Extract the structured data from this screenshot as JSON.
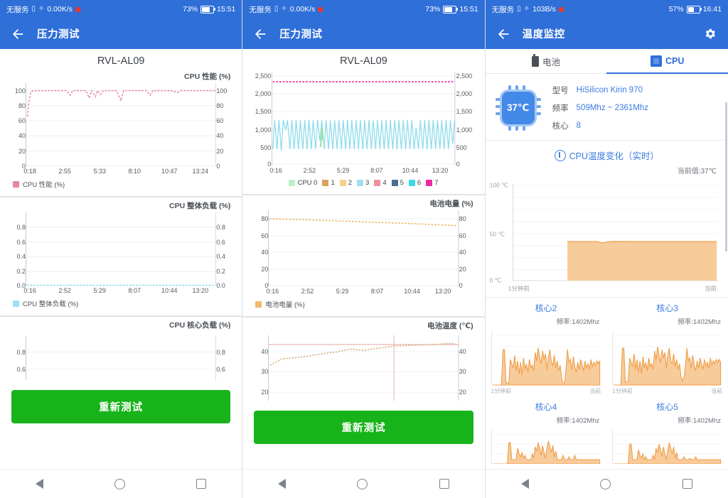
{
  "colors": {
    "brand_blue": "#2f6fd8",
    "green_button": "#18b31b",
    "cpu_perf_pink": "#e8879a",
    "cpu_load_cyan": "#9fdff0",
    "battery_orange": "#f0b96a",
    "temp_orange": "#f3b97c",
    "core_fill": "#f7cb9a",
    "core_stroke": "#f0a04b",
    "link_blue": "#3c7ce0"
  },
  "phone1": {
    "statusbar": {
      "carrier": "无服务",
      "sim_icon": "sim-card-icon",
      "wifi_icon": "wifi-icon",
      "net_speed": "0.00K/s",
      "record_icon": "recording-dot-icon",
      "battery_percent": "73%",
      "battery_icon": "battery-icon",
      "time": "15:51"
    },
    "appbar": {
      "back_icon": "back-arrow-icon",
      "title": "压力测试"
    },
    "device_name": "RVL-AL09",
    "charts": [
      {
        "subtitle": "CPU 性能 (%)",
        "y_ticks": [
          "100",
          "80",
          "60",
          "40",
          "20",
          "0"
        ],
        "x_ticks": [
          "0:18",
          "2:55",
          "5:33",
          "8:10",
          "10:47",
          "13:24"
        ],
        "legend": [
          {
            "label": "CPU 性能 (%)",
            "color": "#e8879a"
          }
        ]
      },
      {
        "subtitle": "CPU 整体负载 (%)",
        "y_ticks": [
          "0.8",
          "0.6",
          "0.4",
          "0.2",
          "0.0"
        ],
        "x_ticks": [
          "0:16",
          "2:52",
          "5:29",
          "8:07",
          "10:44",
          "13:20"
        ],
        "legend": [
          {
            "label": "CPU 整体负载 (%)",
            "color": "#9fdff0"
          }
        ]
      },
      {
        "subtitle": "CPU 核心负载 (%)",
        "y_ticks": [
          "0.8",
          "0.6"
        ],
        "x_ticks": [],
        "legend": []
      }
    ],
    "retest_button": "重新测试",
    "navbar": {
      "back": "nav-back-icon",
      "home": "nav-home-icon",
      "recents": "nav-recents-icon"
    }
  },
  "phone2": {
    "statusbar": {
      "carrier": "无服务",
      "sim_icon": "sim-card-icon",
      "wifi_icon": "wifi-icon",
      "net_speed": "0.00K/s",
      "record_icon": "recording-dot-icon",
      "battery_percent": "73%",
      "battery_icon": "battery-icon",
      "time": "15:51"
    },
    "appbar": {
      "back_icon": "back-arrow-icon",
      "title": "压力测试"
    },
    "device_name": "RVL-AL09",
    "charts": [
      {
        "subtitle": "",
        "y_ticks": [
          "2,500",
          "2,000",
          "1,500",
          "1,000",
          "500",
          "0"
        ],
        "x_ticks": [
          "0:16",
          "2:52",
          "5:29",
          "8:07",
          "10:44",
          "13:20"
        ],
        "legend": [
          {
            "label": "CPU 0",
            "color": "#bdf0c6"
          },
          {
            "label": "1",
            "color": "#d8a45c"
          },
          {
            "label": "2",
            "color": "#f6cf8a"
          },
          {
            "label": "3",
            "color": "#9fdff0"
          },
          {
            "label": "4",
            "color": "#f090a0"
          },
          {
            "label": "5",
            "color": "#4a6f8f"
          },
          {
            "label": "6",
            "color": "#3fd8e8"
          },
          {
            "label": "7",
            "color": "#ef2ba0"
          }
        ]
      },
      {
        "subtitle": "电池电量 (%)",
        "y_ticks": [
          "80",
          "60",
          "40",
          "20",
          "0"
        ],
        "x_ticks": [
          "0:16",
          "2:52",
          "5:29",
          "8:07",
          "10:44",
          "13:20"
        ],
        "legend": [
          {
            "label": "电池电量 (%)",
            "color": "#f0b96a"
          }
        ]
      },
      {
        "subtitle": "电池温度 (℃)",
        "y_ticks": [
          "40",
          "30",
          "20"
        ],
        "x_ticks": [],
        "legend": []
      }
    ],
    "retest_button": "重新测试",
    "navbar": {
      "back": "nav-back-icon",
      "home": "nav-home-icon",
      "recents": "nav-recents-icon"
    }
  },
  "phone3": {
    "statusbar": {
      "carrier": "无服务",
      "sim_icon": "sim-card-icon",
      "wifi_icon": "wifi-icon",
      "net_speed": "103B/s",
      "record_icon": "recording-dot-icon",
      "battery_percent": "57%",
      "battery_icon": "battery-icon",
      "time": "16:41"
    },
    "appbar": {
      "back_icon": "back-arrow-icon",
      "title": "温度监控",
      "settings_icon": "gear-icon"
    },
    "tabs": [
      {
        "label": "电池",
        "icon": "battery-icon",
        "active": false
      },
      {
        "label": "CPU",
        "icon": "cpu-chip-icon",
        "active": true
      }
    ],
    "cpu_info": {
      "chip_temp": "37℃",
      "rows": [
        {
          "key": "型号",
          "value": "HiSilicon Kirin 970"
        },
        {
          "key": "频率",
          "value": "509Mhz ~ 2361Mhz"
        },
        {
          "key": "核心",
          "value": "8"
        }
      ]
    },
    "temp_chart": {
      "title": "CPU温度变化（实时）",
      "title_icon": "thermometer-icon",
      "current_label": "当前值:37℃",
      "y_ticks": [
        "100 ℃",
        "50 ℃",
        "0 ℃"
      ],
      "x_left": "1分钟前",
      "x_right": "当前"
    },
    "cores": [
      {
        "title": "核心2",
        "freq": "频率:1402Mhz",
        "x_left": "1分钟前",
        "x_right": "当前"
      },
      {
        "title": "核心3",
        "freq": "频率:1402Mhz",
        "x_left": "1分钟前",
        "x_right": "当前"
      },
      {
        "title": "核心4",
        "freq": "频率:1402Mhz",
        "x_left": "1分钟前",
        "x_right": "当前"
      },
      {
        "title": "核心5",
        "freq": "频率:1402Mhz",
        "x_left": "1分钟前",
        "x_right": "当前"
      }
    ],
    "navbar": {
      "back": "nav-back-icon",
      "home": "nav-home-icon",
      "recents": "nav-recents-icon"
    }
  },
  "chart_data": [
    {
      "type": "line",
      "title": "CPU 性能 (%)",
      "xlabel": "",
      "ylabel": "CPU 性能 (%)",
      "ylim": [
        0,
        110
      ],
      "xtick_labels": [
        "0:18",
        "2:55",
        "5:33",
        "8:10",
        "10:47",
        "13:24"
      ],
      "ytick_labels": [
        "0",
        "20",
        "40",
        "60",
        "80",
        "100"
      ],
      "series": [
        {
          "name": "CPU 性能 (%)",
          "color": "#e8879a",
          "values": [
            65,
            84,
            97,
            100,
            100,
            100,
            100,
            100,
            100,
            100,
            100,
            100,
            100,
            100,
            100,
            100,
            96,
            100,
            100,
            100,
            100,
            100,
            90,
            100,
            94,
            100,
            92,
            100,
            96,
            100,
            100,
            100,
            100,
            100,
            100,
            86,
            100,
            100,
            100,
            100,
            100,
            100,
            100,
            96,
            100,
            100,
            100,
            100,
            98,
            100,
            100,
            100,
            100,
            100
          ]
        }
      ]
    },
    {
      "type": "line",
      "title": "CPU 整体负载 (%)",
      "ylabel": "CPU 整体负载 (%)",
      "ylim": [
        0,
        0.9
      ],
      "xtick_labels": [
        "0:16",
        "2:52",
        "5:29",
        "8:07",
        "10:44",
        "13:20"
      ],
      "ytick_labels": [
        "0.0",
        "0.2",
        "0.4",
        "0.6",
        "0.8"
      ],
      "series": [
        {
          "name": "CPU 整体负载 (%)",
          "color": "#9fdff0",
          "values": [
            0,
            0,
            0,
            0,
            0,
            0,
            0,
            0,
            0,
            0
          ]
        }
      ]
    },
    {
      "type": "line",
      "title": "CPU 核心负载 (%)",
      "ylabel": "CPU 核心负载 (%)",
      "ylim": [
        0.5,
        0.9
      ],
      "ytick_labels": [
        "0.6",
        "0.8"
      ],
      "series": []
    },
    {
      "type": "line",
      "title": "CPU 频率 (Mhz)",
      "ylim": [
        0,
        2600
      ],
      "xtick_labels": [
        "0:16",
        "2:52",
        "5:29",
        "8:07",
        "10:44",
        "13:20"
      ],
      "ytick_labels": [
        "0",
        "500",
        "1,000",
        "1,500",
        "2,000",
        "2,500"
      ],
      "series": [
        {
          "name": "CPU 0",
          "color": "#bdf0c6",
          "values": [
            1200,
            1200,
            1200,
            1200,
            1200,
            1200
          ]
        },
        {
          "name": "3",
          "color": "#9fdff0",
          "note": "oscillating 500→1850 sawtooth, ~44 cycles",
          "min": 500,
          "max": 1850
        },
        {
          "name": "7",
          "color": "#ef2ba0",
          "note": "flat dotted line at 2361",
          "values": [
            2361,
            2361,
            2361,
            2361,
            2361,
            2361
          ]
        }
      ]
    },
    {
      "type": "line",
      "title": "电池电量 (%)",
      "ylabel": "电池电量 (%)",
      "ylim": [
        0,
        88
      ],
      "xtick_labels": [
        "0:16",
        "2:52",
        "5:29",
        "8:07",
        "10:44",
        "13:20"
      ],
      "ytick_labels": [
        "0",
        "20",
        "40",
        "60",
        "80"
      ],
      "series": [
        {
          "name": "电池电量 (%)",
          "color": "#f0b96a",
          "values": [
            80,
            80,
            79,
            79,
            79,
            78,
            78,
            78,
            77,
            77,
            77,
            76,
            76,
            75,
            75,
            74,
            74,
            73
          ]
        }
      ]
    },
    {
      "type": "line",
      "title": "电池温度 (℃)",
      "ylabel": "电池温度 (℃)",
      "ylim": [
        18,
        50
      ],
      "ytick_labels": [
        "20",
        "30",
        "40"
      ],
      "series": [
        {
          "name": "电池温度 (℃)",
          "color": "#d9b68e",
          "values": [
            32,
            34,
            36,
            37,
            37,
            38,
            38,
            38,
            39,
            39,
            40,
            40,
            41,
            41,
            42,
            42,
            43,
            42,
            42,
            43,
            43,
            43,
            44,
            44,
            44,
            44,
            44,
            45,
            45,
            44
          ]
        }
      ]
    },
    {
      "type": "area",
      "title": "CPU温度变化（实时）",
      "ylim": [
        0,
        100
      ],
      "ytick_labels": [
        "0 ℃",
        "50 ℃",
        "100 ℃"
      ],
      "xtick_labels": [
        "1分钟前",
        "当前"
      ],
      "series": [
        {
          "name": "CPU 温度",
          "color": "#f3b97c",
          "values": [
            37,
            37,
            37,
            37,
            37,
            36,
            36,
            37,
            37,
            37,
            37,
            37,
            37,
            37,
            37,
            37,
            37
          ]
        }
      ]
    },
    {
      "type": "area",
      "title": "核心2",
      "annotation": "频率:1402Mhz",
      "xtick_labels": [
        "1分钟前",
        "当前"
      ],
      "series": [
        {
          "name": "核心2",
          "color": "#f0a04b",
          "values": [
            0,
            0,
            62,
            4,
            4,
            30,
            45,
            22,
            48,
            20,
            42,
            18,
            30,
            26,
            34,
            24,
            52,
            38,
            72,
            44,
            58,
            36,
            62,
            50,
            56,
            30,
            10,
            6,
            70,
            34,
            40,
            26,
            44,
            38
          ]
        }
      ]
    },
    {
      "type": "area",
      "title": "核心3",
      "annotation": "频率:1402Mhz",
      "xtick_labels": [
        "1分钟前",
        "当前"
      ],
      "series": [
        {
          "name": "核心3",
          "color": "#f0a04b",
          "values": [
            0,
            0,
            64,
            6,
            6,
            34,
            48,
            26,
            50,
            22,
            44,
            20,
            34,
            28,
            36,
            26,
            56,
            40,
            74,
            46,
            60,
            38,
            64,
            52,
            58,
            32,
            14,
            10,
            72,
            36,
            42,
            28,
            46,
            40
          ]
        }
      ]
    },
    {
      "type": "area",
      "title": "核心4",
      "annotation": "频率:1402Mhz",
      "xtick_labels": [
        "1分钟前",
        "当前"
      ],
      "series": [
        {
          "name": "核心4",
          "color": "#f0a04b",
          "values": [
            0,
            0,
            40,
            10,
            6,
            20,
            26,
            16,
            12,
            8,
            4,
            2,
            34,
            12,
            44,
            20,
            42,
            30,
            38,
            26,
            52,
            34,
            30,
            18,
            10,
            6,
            14,
            8,
            10,
            6,
            12,
            8
          ]
        }
      ]
    },
    {
      "type": "area",
      "title": "核心5",
      "annotation": "频率:1402Mhz",
      "xtick_labels": [
        "1分钟前",
        "当前"
      ],
      "series": [
        {
          "name": "核心5",
          "color": "#f0a04b",
          "values": [
            0,
            0,
            42,
            12,
            8,
            22,
            28,
            18,
            14,
            10,
            6,
            4,
            36,
            14,
            46,
            22,
            44,
            32,
            40,
            28,
            54,
            36,
            32,
            20,
            12,
            8,
            16,
            10,
            12,
            8,
            14,
            10
          ]
        }
      ]
    }
  ]
}
